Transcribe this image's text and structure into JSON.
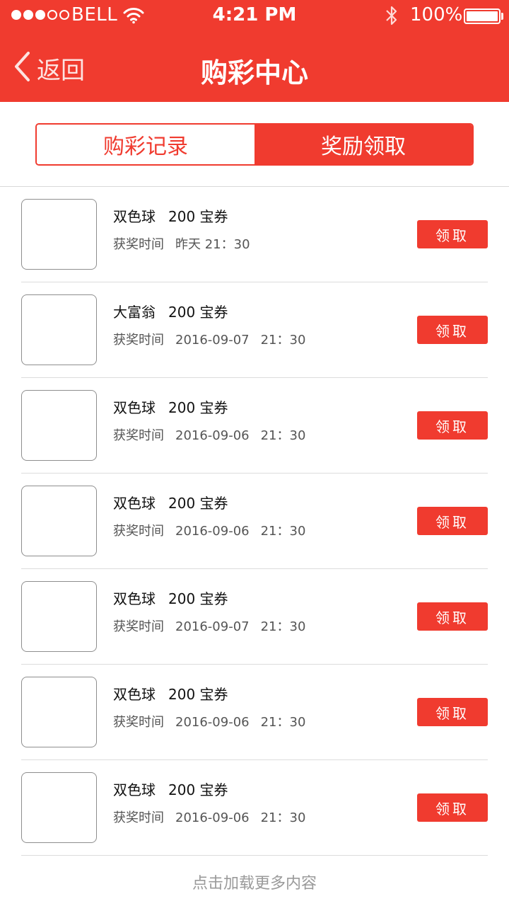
{
  "status_bar": {
    "signal_dots": [
      "filled",
      "filled",
      "filled",
      "empty",
      "empty"
    ],
    "carrier": "BELL",
    "wifi_icon": "wifi-icon",
    "time": "4:21 PM",
    "bluetooth_icon": "bluetooth-icon",
    "battery_percent": "100%",
    "battery_level": 1.0
  },
  "nav": {
    "back_label": "返回",
    "back_icon": "chevron-left-icon",
    "title": "购彩中心"
  },
  "tabs": [
    {
      "label": "购彩记录",
      "active": false
    },
    {
      "label": "奖励领取",
      "active": true
    }
  ],
  "colors": {
    "accent": "#f03b2f",
    "divider": "#dcdcdc",
    "muted_text": "#9a9a9a"
  },
  "list": {
    "time_label": "获奖时间",
    "claim_label": "领取",
    "items": [
      {
        "lottery": "双色球",
        "reward": "200 宝券",
        "date": "昨天",
        "time": "21：30"
      },
      {
        "lottery": "大富翁",
        "reward": "200 宝券",
        "date": "2016-09-07",
        "time": "21：30"
      },
      {
        "lottery": "双色球",
        "reward": "200 宝券",
        "date": "2016-09-06",
        "time": "21：30"
      },
      {
        "lottery": "双色球",
        "reward": "200 宝券",
        "date": "2016-09-06",
        "time": "21：30"
      },
      {
        "lottery": "双色球",
        "reward": "200 宝券",
        "date": "2016-09-07",
        "time": "21：30"
      },
      {
        "lottery": "双色球",
        "reward": "200 宝券",
        "date": "2016-09-06",
        "time": "21：30"
      },
      {
        "lottery": "双色球",
        "reward": "200 宝券",
        "date": "2016-09-06",
        "time": "21：30"
      }
    ]
  },
  "footer": {
    "load_more": "点击加载更多内容"
  }
}
